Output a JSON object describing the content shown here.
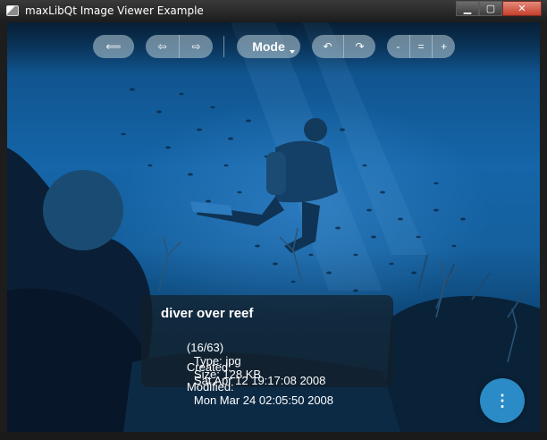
{
  "window": {
    "title": "maxLibQt Image Viewer Example",
    "buttons": {
      "minimize": "▁",
      "maximize": "▢",
      "close": "✕"
    }
  },
  "toolbar": {
    "back_icon": "⟸",
    "prev_icon": "⇦",
    "next_icon": "⇨",
    "mode_label": "Mode",
    "rotate_left_icon": "↶",
    "rotate_right_icon": "↷",
    "zoom_out_label": "-",
    "zoom_reset_label": "=",
    "zoom_in_label": "+"
  },
  "info": {
    "name": "diver over reef",
    "index": "(16/63)",
    "type": "Type: jpg",
    "size": "Size: 128 KB",
    "created_label": "Created:",
    "created_value": "Sat Apr 12 19:17:08 2008",
    "modified_label": "Modified:",
    "modified_value": "Mon Mar 24 02:05:50 2008"
  },
  "fab": {
    "label": "⋮"
  },
  "colors": {
    "fab": "#2d91cd",
    "water_mid": "#1565a8"
  }
}
